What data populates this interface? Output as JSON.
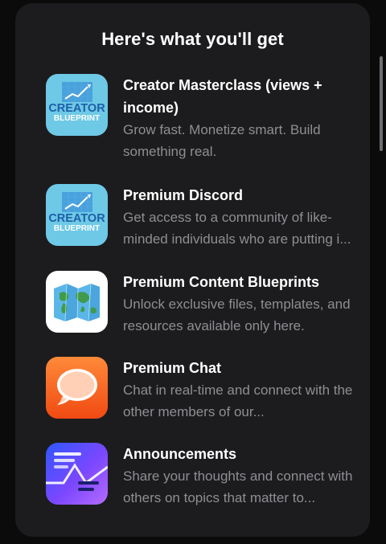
{
  "header": {
    "title": "Here's what you'll get"
  },
  "items": [
    {
      "name": "Creator Masterclass (views + income)",
      "description": "Grow fast. Monetize smart. Build something real.",
      "icon": "creator-blueprint-logo",
      "icon_lines": [
        "CREATOR",
        "BLUEPRINT"
      ]
    },
    {
      "name": "Premium Discord",
      "description": "Get access to a community of like-minded individuals who are putting i...",
      "icon": "creator-blueprint-logo",
      "icon_lines": [
        "CREATOR",
        "BLUEPRINT"
      ]
    },
    {
      "name": "Premium Content Blueprints",
      "description": "Unlock exclusive files, templates, and resources available only here.",
      "icon": "map-icon"
    },
    {
      "name": "Premium Chat",
      "description": "Chat in real-time and connect with the other members of our...",
      "icon": "speech-bubble-icon"
    },
    {
      "name": "Announcements",
      "description": "Share your thoughts and connect with others on topics that matter to...",
      "icon": "announcement-icon"
    }
  ],
  "colors": {
    "card_background": "#1c1c1e",
    "page_background": "#0b0b0b",
    "title_text": "#ffffff",
    "description_text": "#8e8e93",
    "blueprint_bg": "#6ec9e6",
    "blueprint_text": "#1d5fa8",
    "chat_orange": "#f2621e",
    "announce_purple": "#5b4dff"
  }
}
